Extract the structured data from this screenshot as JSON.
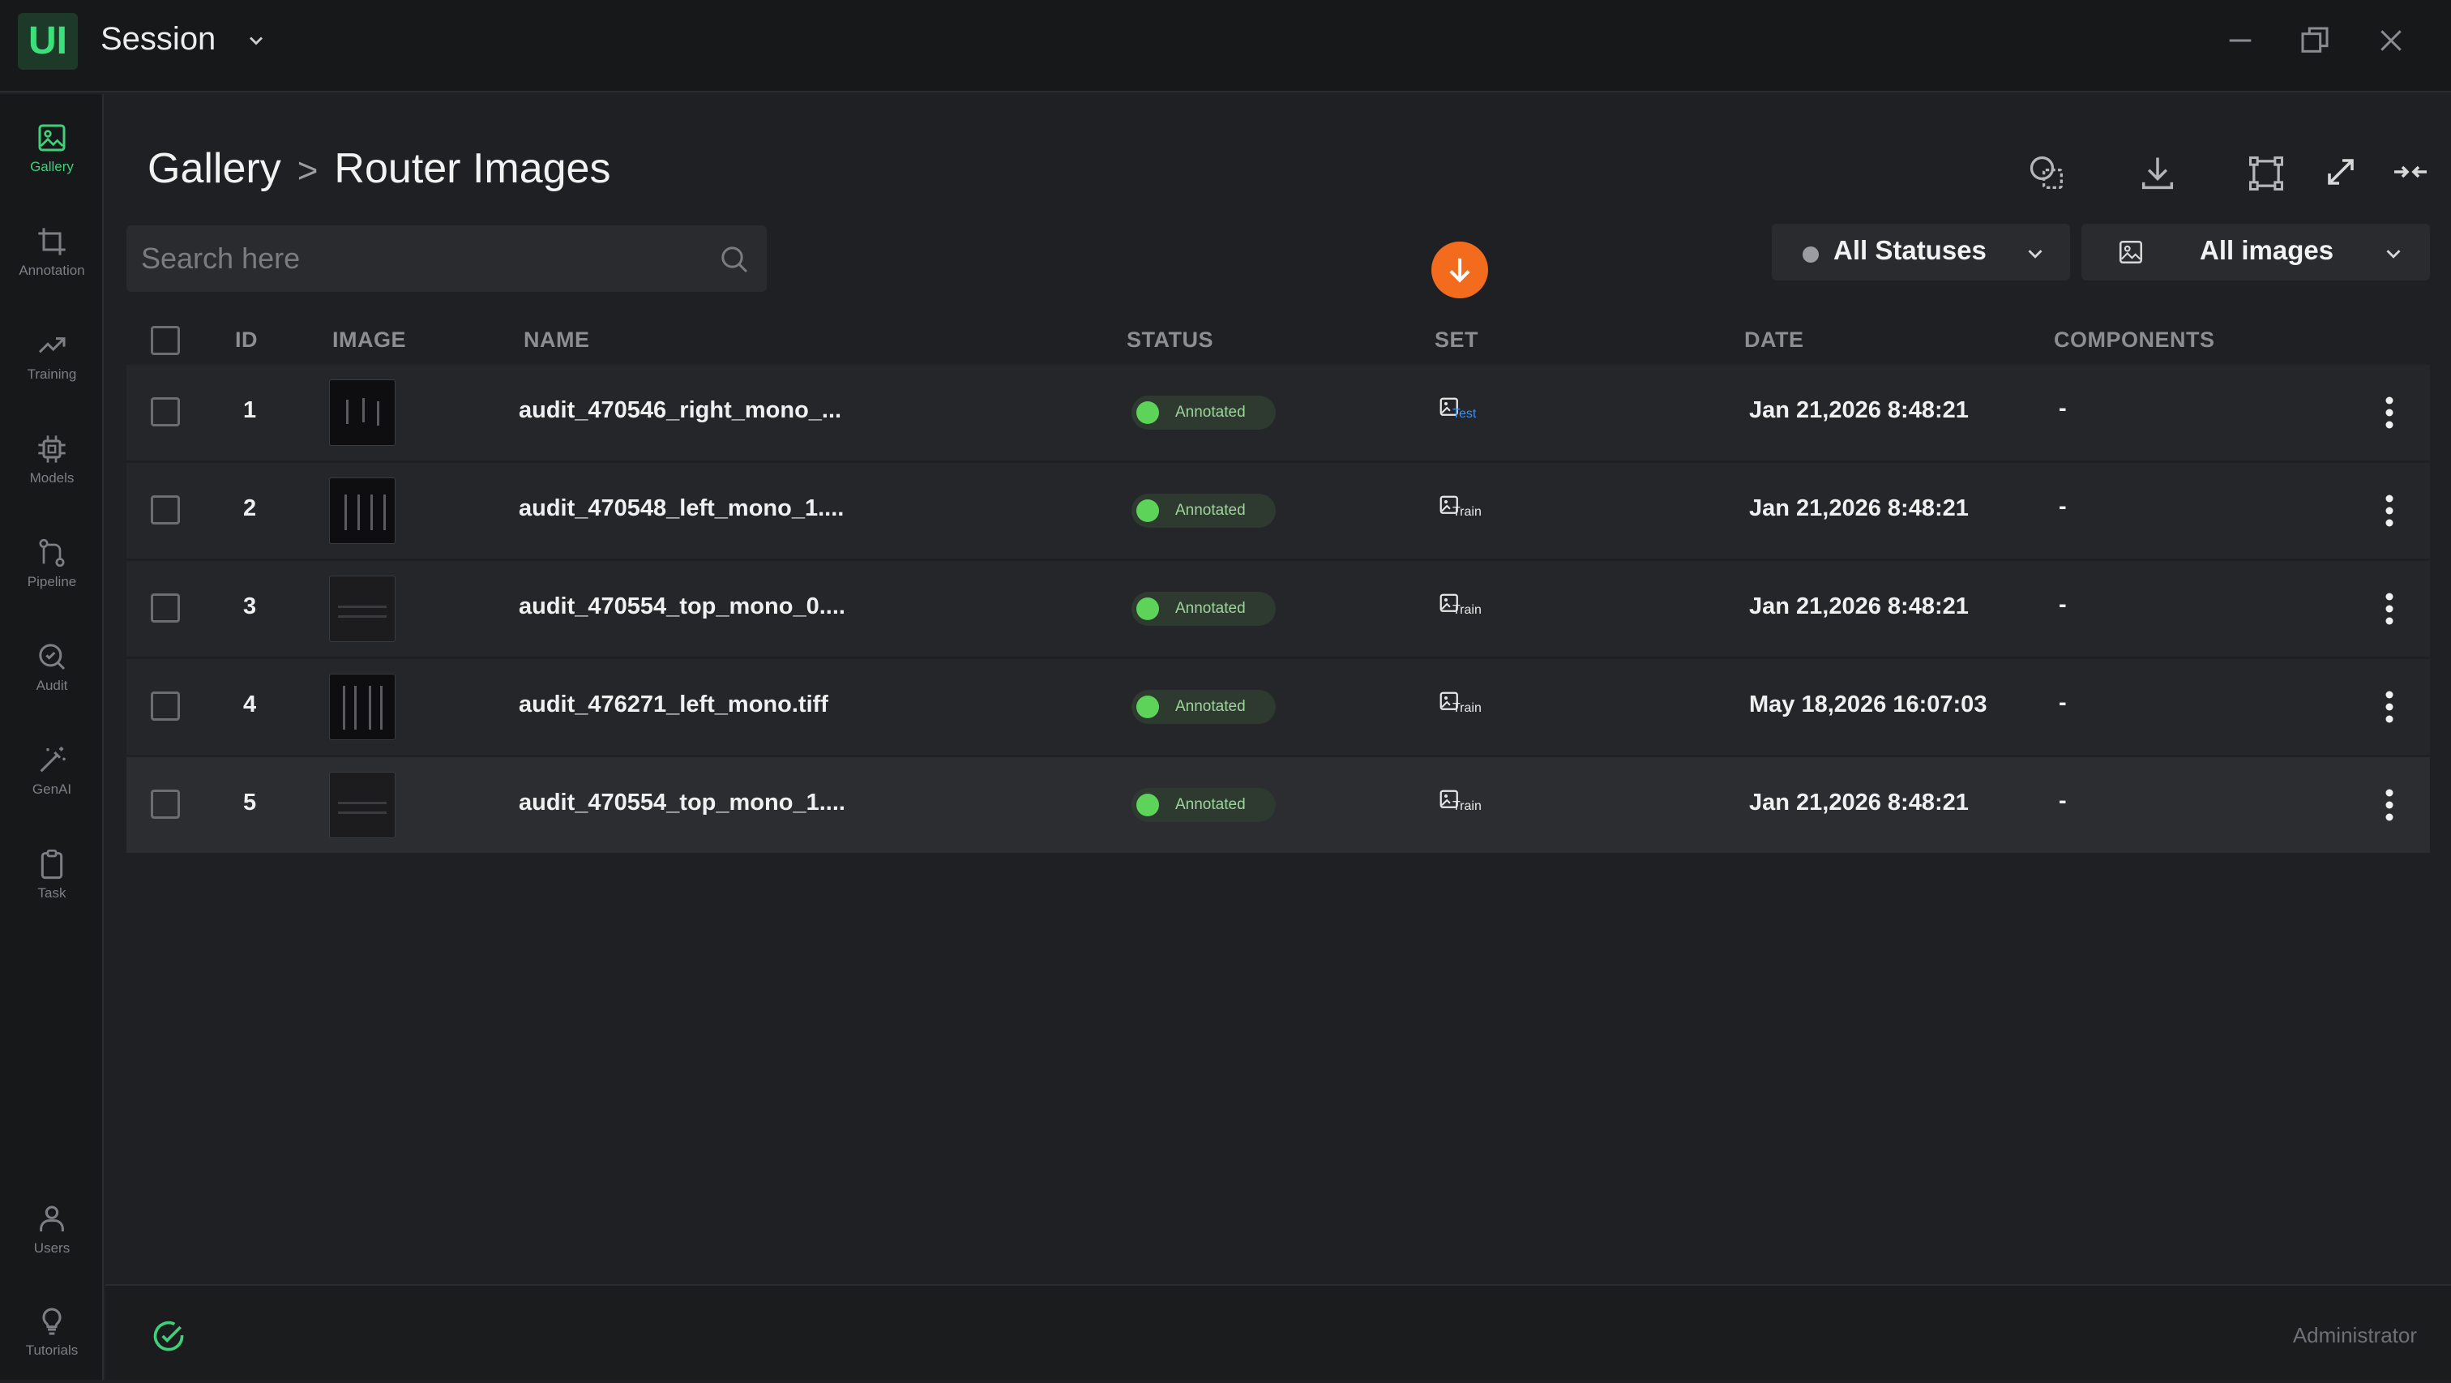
{
  "app": {
    "logo": "UI",
    "title": "Session"
  },
  "sidebar": {
    "items": [
      {
        "label": "Gallery",
        "icon": "gallery-icon",
        "active": true
      },
      {
        "label": "Annotation",
        "icon": "crop-icon"
      },
      {
        "label": "Training",
        "icon": "trending-up-icon"
      },
      {
        "label": "Models",
        "icon": "chip-icon"
      },
      {
        "label": "Pipeline",
        "icon": "pipeline-icon"
      },
      {
        "label": "Audit",
        "icon": "audit-search-icon"
      },
      {
        "label": "GenAI",
        "icon": "magic-wand-icon"
      },
      {
        "label": "Task",
        "icon": "clipboard-icon"
      }
    ],
    "bottom": [
      {
        "label": "Users",
        "icon": "user-icon"
      },
      {
        "label": "Tutorials",
        "icon": "lightbulb-icon"
      }
    ]
  },
  "breadcrumb": {
    "root": "Gallery",
    "separator": ">",
    "current": "Router Images"
  },
  "search": {
    "placeholder": "Search here",
    "value": ""
  },
  "filters": {
    "status": "All Statuses",
    "images": "All images"
  },
  "table": {
    "headers": {
      "id": "ID",
      "image": "IMAGE",
      "name": "NAME",
      "status": "STATUS",
      "set": "SET",
      "date": "DATE",
      "components": "COMPONENTS"
    },
    "rows": [
      {
        "id": "1",
        "name": "audit_470546_right_mono_...",
        "status": "Annotated",
        "set": "Test",
        "date": "Jan 21,2026 8:48:21",
        "components": "-"
      },
      {
        "id": "2",
        "name": "audit_470548_left_mono_1....",
        "status": "Annotated",
        "set": "Train",
        "date": "Jan 21,2026 8:48:21",
        "components": "-"
      },
      {
        "id": "3",
        "name": "audit_470554_top_mono_0....",
        "status": "Annotated",
        "set": "Train",
        "date": "Jan 21,2026 8:48:21",
        "components": "-"
      },
      {
        "id": "4",
        "name": "audit_476271_left_mono.tiff",
        "status": "Annotated",
        "set": "Train",
        "date": "May 18,2026 16:07:03",
        "components": "-"
      },
      {
        "id": "5",
        "name": "audit_470554_top_mono_1....",
        "status": "Annotated",
        "set": "Train",
        "date": "Jan 21,2026 8:48:21",
        "components": "-"
      }
    ]
  },
  "footer": {
    "role": "Administrator"
  },
  "colors": {
    "accent": "#3fd07a",
    "annotated": "#5dd35a",
    "orange": "#f36c1d",
    "test": "#3d8ff0"
  }
}
